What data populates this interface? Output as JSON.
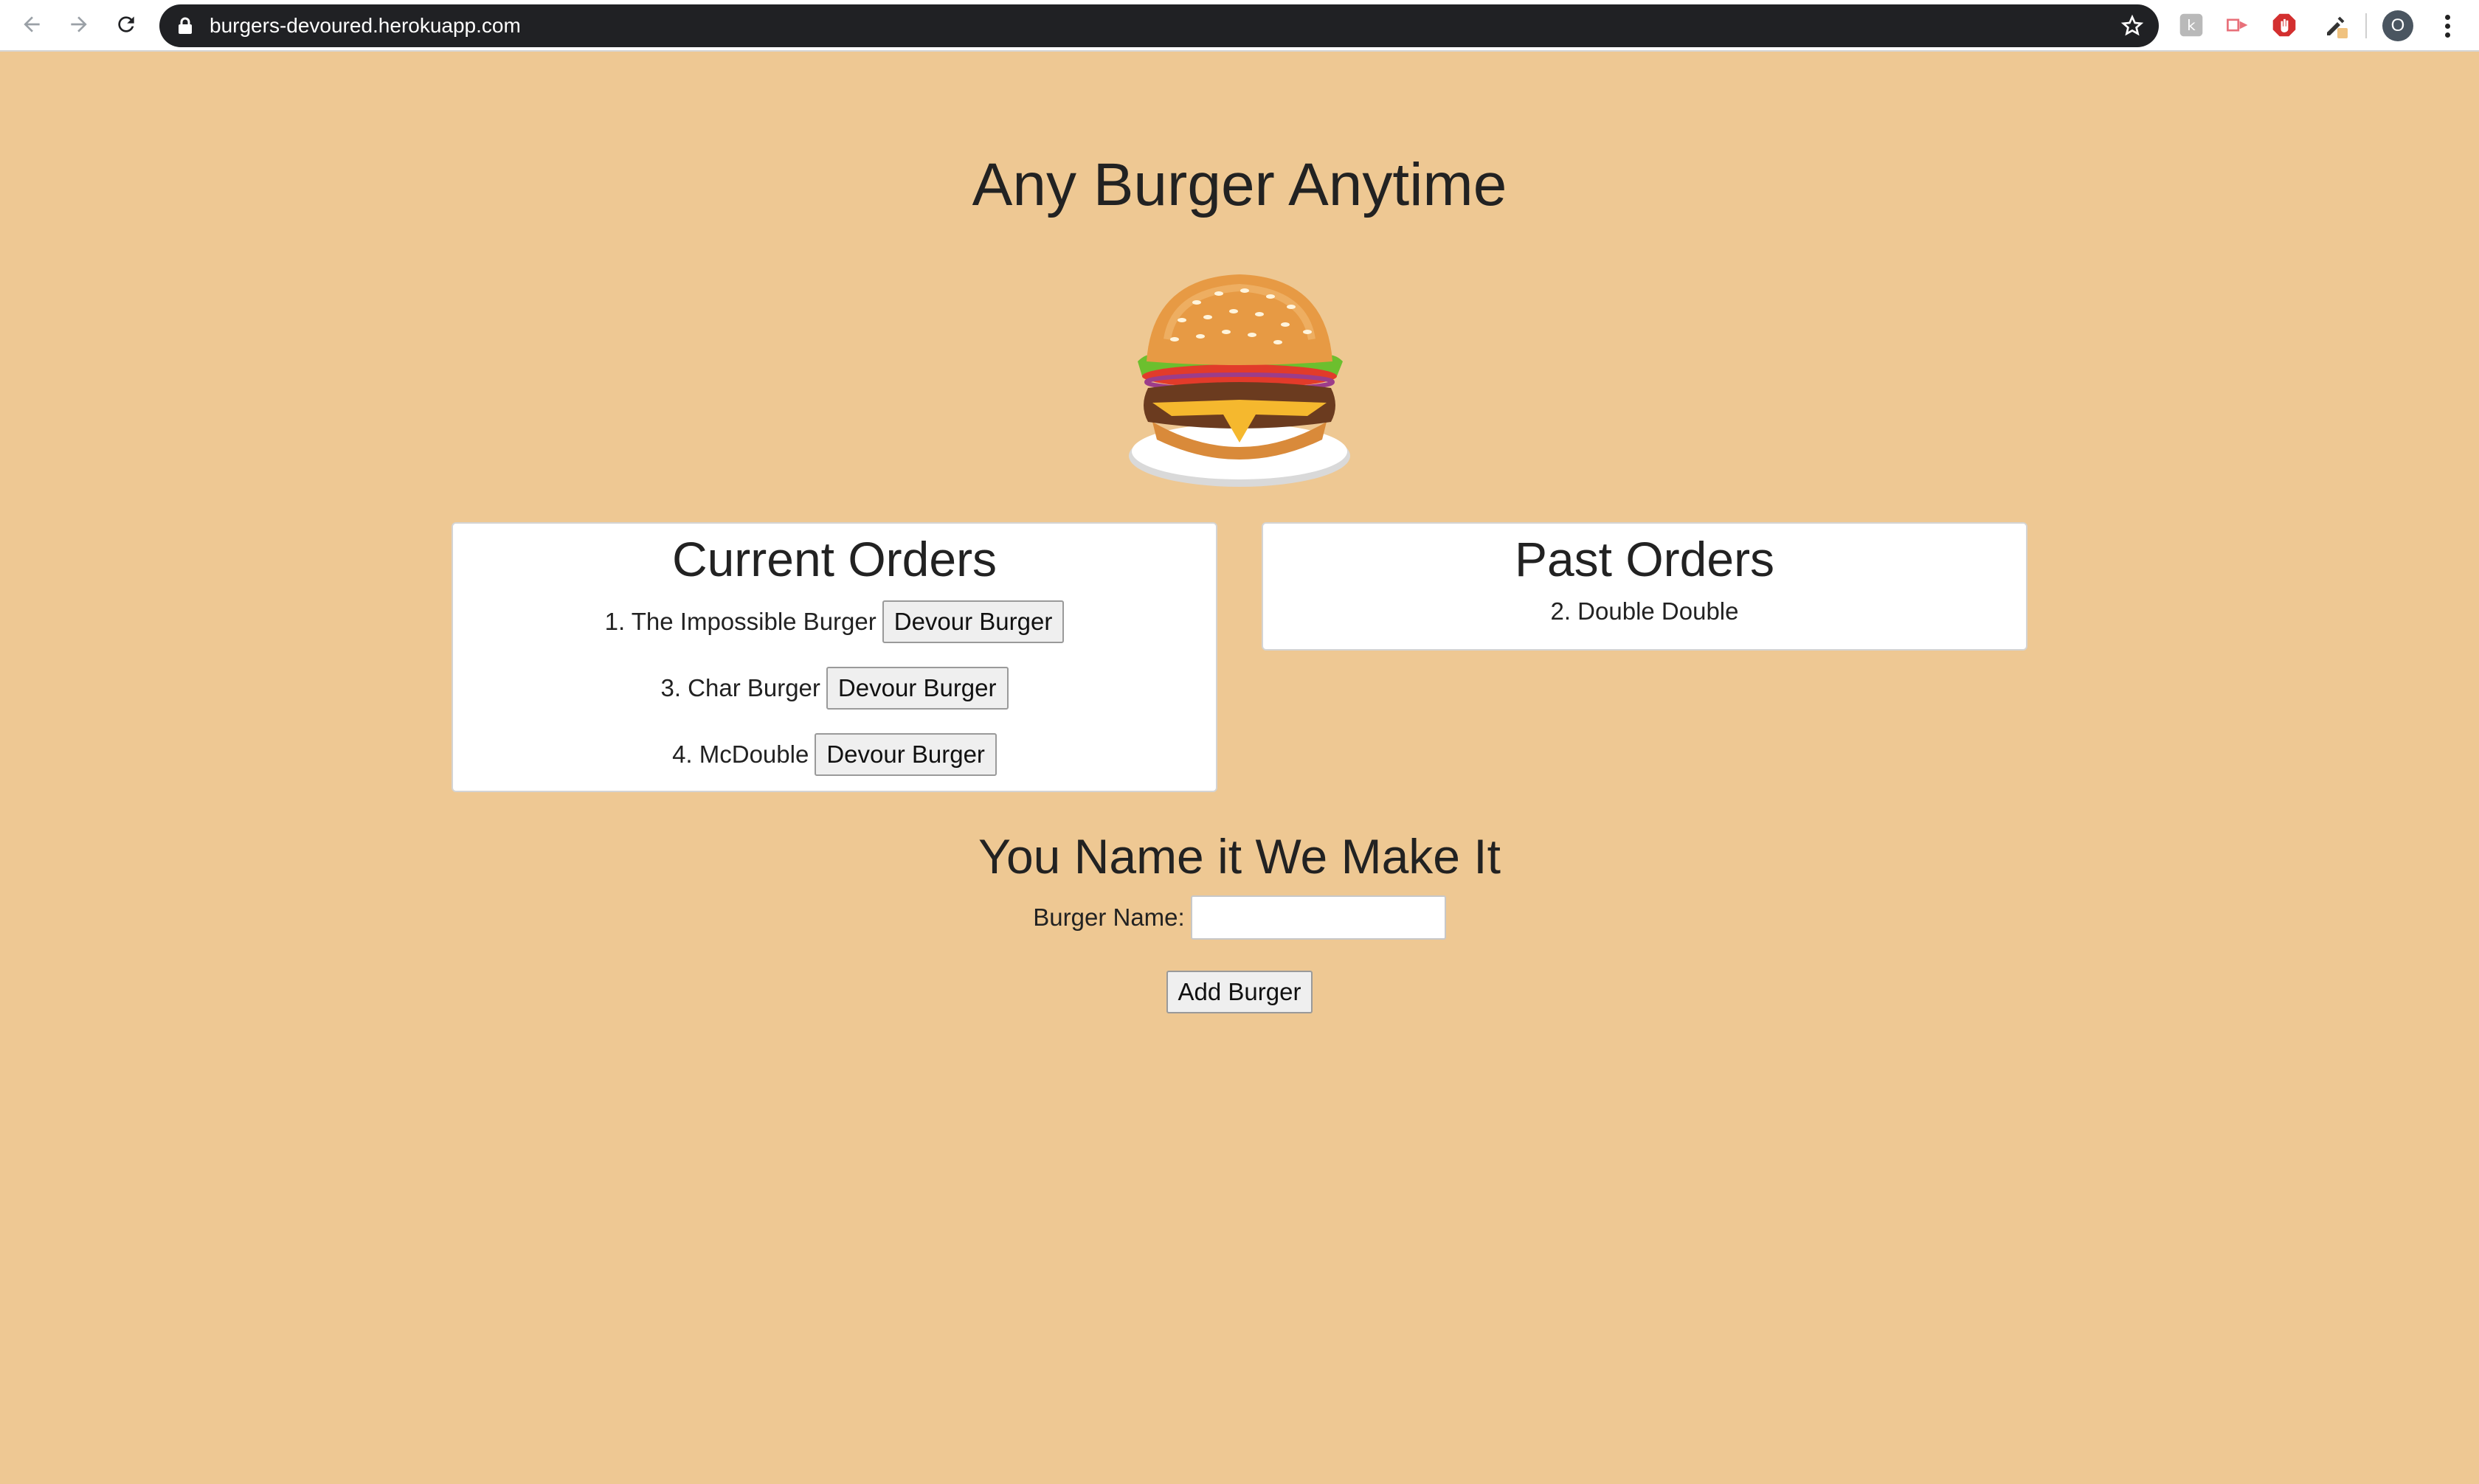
{
  "browser": {
    "url": "burgers-devoured.herokuapp.com",
    "profile_initial": "O",
    "omnibox_color": "#202124"
  },
  "page": {
    "background_color": "#eec893",
    "title": "Any Burger Anytime",
    "image_icon": "burger-illustration"
  },
  "current_orders": {
    "heading": "Current Orders",
    "items": [
      {
        "label": "1. The Impossible Burger",
        "button": "Devour Burger"
      },
      {
        "label": "3. Char Burger",
        "button": "Devour Burger"
      },
      {
        "label": "4. McDouble",
        "button": "Devour Burger"
      }
    ]
  },
  "past_orders": {
    "heading": "Past Orders",
    "items": [
      {
        "label": "2. Double Double"
      }
    ]
  },
  "form": {
    "heading": "You Name it We Make It",
    "label": "Burger Name:",
    "input_value": "",
    "submit_label": "Add Burger"
  }
}
